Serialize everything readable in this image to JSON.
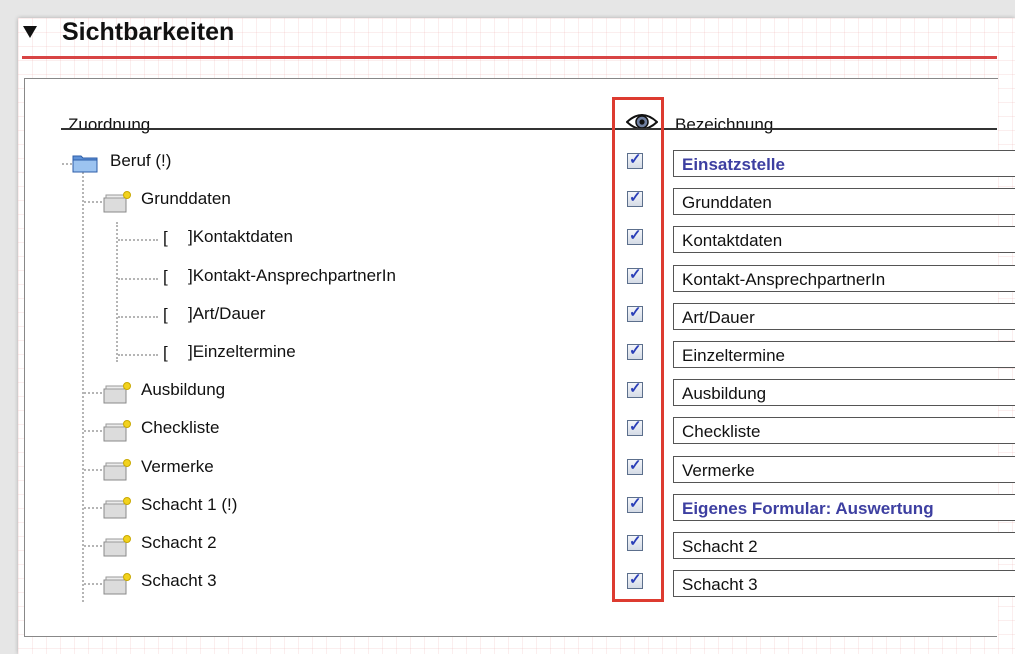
{
  "section": {
    "title": "Sichtbarkeiten"
  },
  "columns": {
    "assignment": "Zuordnung",
    "visibility_icon": "eye-icon",
    "label": "Bezeichnung"
  },
  "colors": {
    "accent": "#3d3fa1",
    "highlight": "#dd3b30",
    "rule": "#d84444"
  },
  "rows": [
    {
      "tree_label": "Beruf (!)",
      "icon": "folder-icon",
      "visible": true,
      "bezeichnung": "Einsatzstelle",
      "accent": true
    },
    {
      "tree_label": "Grunddaten",
      "icon": "page-icon",
      "visible": true,
      "bezeichnung": "Grunddaten",
      "accent": false
    },
    {
      "tree_label": "]Kontaktdaten",
      "icon": "bracket",
      "visible": true,
      "bezeichnung": "Kontaktdaten",
      "accent": false
    },
    {
      "tree_label": "]Kontakt-AnsprechpartnerIn",
      "icon": "bracket",
      "visible": true,
      "bezeichnung": "Kontakt-AnsprechpartnerIn",
      "accent": false
    },
    {
      "tree_label": "]Art/Dauer",
      "icon": "bracket",
      "visible": true,
      "bezeichnung": "Art/Dauer",
      "accent": false
    },
    {
      "tree_label": "]Einzeltermine",
      "icon": "bracket",
      "visible": true,
      "bezeichnung": "Einzeltermine",
      "accent": false
    },
    {
      "tree_label": "Ausbildung",
      "icon": "page-icon",
      "visible": true,
      "bezeichnung": "Ausbildung",
      "accent": false
    },
    {
      "tree_label": "Checkliste",
      "icon": "page-icon",
      "visible": true,
      "bezeichnung": "Checkliste",
      "accent": false
    },
    {
      "tree_label": "Vermerke",
      "icon": "page-icon",
      "visible": true,
      "bezeichnung": "Vermerke",
      "accent": false
    },
    {
      "tree_label": "Schacht 1 (!)",
      "icon": "page-icon",
      "visible": true,
      "bezeichnung": "Eigenes Formular: Auswertung",
      "accent": true
    },
    {
      "tree_label": "Schacht 2",
      "icon": "page-icon",
      "visible": true,
      "bezeichnung": "Schacht 2",
      "accent": false
    },
    {
      "tree_label": "Schacht 3",
      "icon": "page-icon",
      "visible": true,
      "bezeichnung": "Schacht 3",
      "accent": false
    }
  ],
  "bracket_glyph": "["
}
